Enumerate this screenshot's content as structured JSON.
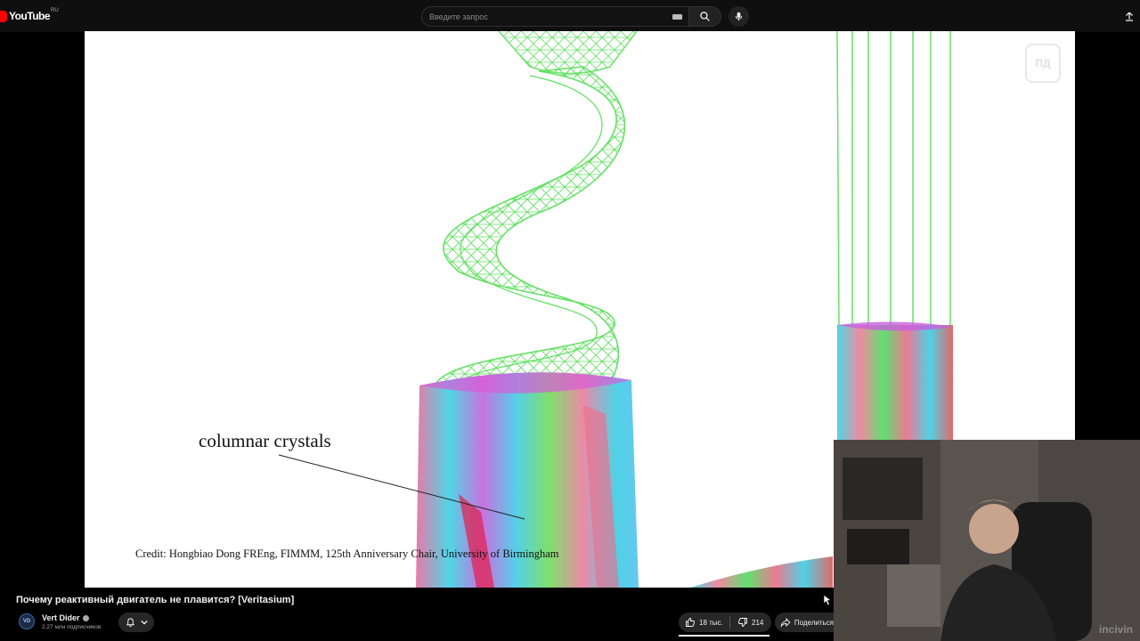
{
  "header": {
    "logo_text": "YouTube",
    "logo_region": "RU",
    "search_placeholder": "Введите запрос",
    "icons": [
      "keyboard-icon",
      "search-icon",
      "mic-icon",
      "upload-icon"
    ]
  },
  "video": {
    "annotation_label": "columnar crystals",
    "credit": "Credit: Hongbiao Dong FREng, FIMMM, 125th Anniversary Chair, University of Birmingham",
    "watermark_text": "ПД",
    "webcam_watermark": "incivin"
  },
  "info": {
    "title": "Почему реактивный двигатель не плавится? [Veritasium]",
    "channel_name": "Vert Dider",
    "avatar_text": "VD",
    "subscribers": "2,27 млн подписчиков",
    "likes": "18 тыс.",
    "dislikes": "214",
    "share_label": "Поделиться"
  },
  "colors": {
    "brand_red": "#ff0000",
    "background": "#0f0f0f",
    "wireframe_green": "#5de05d"
  }
}
